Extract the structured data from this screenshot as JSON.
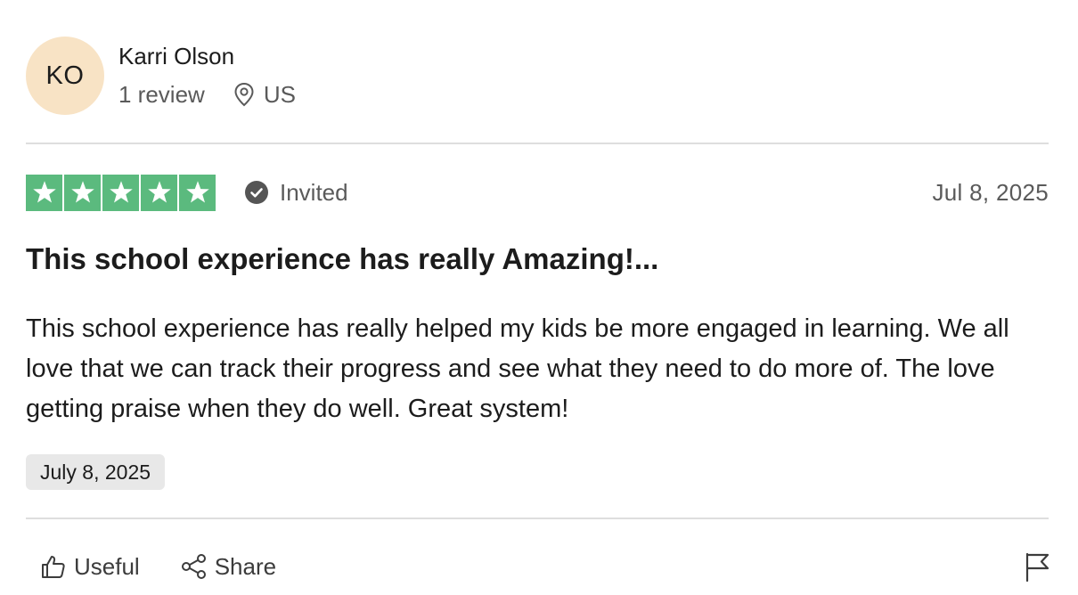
{
  "reviewer": {
    "initials": "KO",
    "name": "Karri Olson",
    "review_count": "1 review",
    "country": "US"
  },
  "review": {
    "rating": 5,
    "rating_max": 5,
    "star_color": "#5bba7e",
    "verification": "Invited",
    "date": "Jul 8, 2025",
    "title": "This school experience has really Amazing!...",
    "body": "This school experience has really helped my kids be more engaged in learning. We all love that we can track their progress and see what they need to do more of. The love getting praise when they do well. Great system!",
    "experience_date": "July 8, 2025"
  },
  "actions": {
    "useful_label": "Useful",
    "share_label": "Share"
  },
  "icons": {
    "location": "location-pin-icon",
    "verified": "check-circle-icon",
    "useful": "thumbs-up-icon",
    "share": "share-icon",
    "report": "flag-icon"
  }
}
